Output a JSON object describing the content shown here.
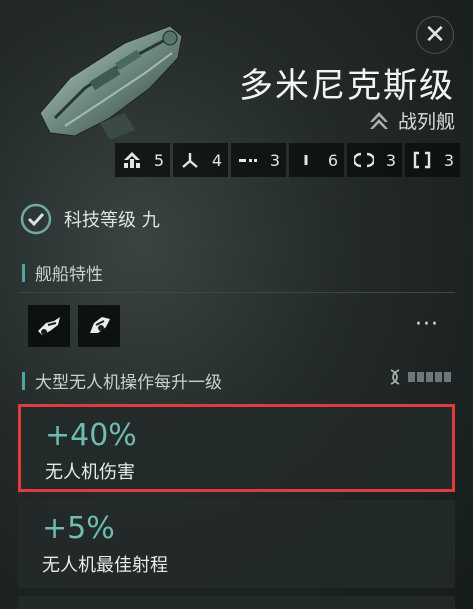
{
  "ship": {
    "name": "多米尼克斯级",
    "class_label": "战列舰",
    "class_icon": "battleship-class-icon"
  },
  "close_icon": "close-icon",
  "slots": [
    {
      "icon": "high-slot-icon",
      "value": "5"
    },
    {
      "icon": "drone-icon",
      "value": "4"
    },
    {
      "icon": "turret-icon",
      "value": "3"
    },
    {
      "icon": "launcher-icon",
      "value": "6"
    },
    {
      "icon": "mid-slot-icon",
      "value": "3"
    },
    {
      "icon": "low-slot-icon",
      "value": "3"
    }
  ],
  "tech": {
    "label": "科技等级 九"
  },
  "traits": {
    "title": "舰船特性",
    "icons": [
      "drone-bay-trait-icon",
      "drone-control-trait-icon"
    ],
    "more": "···"
  },
  "level_section": {
    "title": "大型无人机操作每升一级",
    "pips": 5
  },
  "bonuses": [
    {
      "value": "+40%",
      "label": "无人机伤害"
    },
    {
      "value": "+5%",
      "label": "无人机最佳射程"
    },
    {
      "value": "",
      "label": ""
    }
  ],
  "colors": {
    "accent": "#4ea6a0",
    "bonus_value": "#6fbcb3",
    "highlight_border": "#e23b3b"
  }
}
